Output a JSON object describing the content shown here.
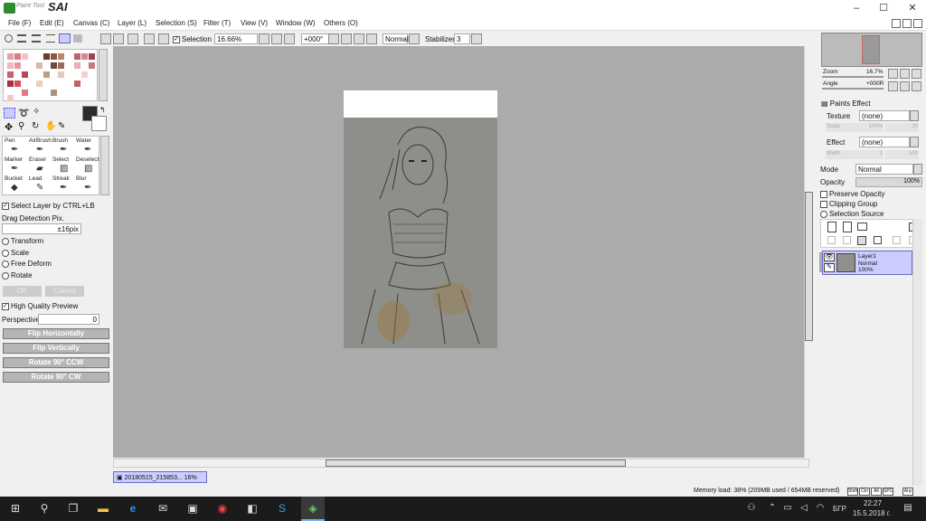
{
  "app": {
    "logo_text": "Paint Tool",
    "logo_name": "SAI"
  },
  "window_controls": {
    "minimize": "–",
    "maximize": "☐",
    "close": "✕"
  },
  "menu": [
    "File (F)",
    "Edit (E)",
    "Canvas (C)",
    "Layer (L)",
    "Selection (S)",
    "Filter (T)",
    "View (V)",
    "Window (W)",
    "Others (O)"
  ],
  "toolbar": {
    "selection_label": "Selection",
    "zoom": "16.66%",
    "angle": "+000°",
    "blend": "Normal",
    "stabilizer_label": "Stabilizer",
    "stabilizer_value": "3"
  },
  "tools": {
    "row1": [
      "Pen",
      "AirBrush",
      "Brush",
      "Water"
    ],
    "row2": [
      "Marker",
      "Eraser",
      "Select",
      "Deselect"
    ],
    "row3": [
      "Bucket",
      "Lead",
      "Streak",
      "Blur"
    ]
  },
  "left_options": {
    "select_layer": "Select Layer by CTRL+LB",
    "drag_detection": "Drag Detection Pix.",
    "drag_value": "±16pix",
    "transform_options": [
      "Transform",
      "Scale",
      "Free Deform",
      "Rotate"
    ],
    "ok": "OK",
    "cancel": "Cancel",
    "high_quality": "High Quality Preview",
    "perspective_label": "Perspective",
    "perspective_value": "0",
    "buttons": [
      "Flip Horizontally",
      "Flip Vertically",
      "Rotate 90° CCW",
      "Rotate 90° CW"
    ]
  },
  "navigator": {
    "zoom_label": "Zoom",
    "zoom_value": "16.7%",
    "angle_label": "Angle",
    "angle_value": "+000R"
  },
  "paints_effect": {
    "header": "Paints Effect",
    "texture_label": "Texture",
    "texture_value": "(none)",
    "scale_label": "Scale",
    "scale_value": "100%",
    "scale_num": "20",
    "effect_label": "Effect",
    "effect_value": "(none)",
    "width_label": "Width",
    "width_value": "1",
    "width_num": "100"
  },
  "layer_props": {
    "mode_label": "Mode",
    "mode_value": "Normal",
    "opacity_label": "Opacity",
    "opacity_value": "100%",
    "preserve": "Preserve Opacity",
    "clipping": "Clipping Group",
    "selection_source": "Selection Source"
  },
  "layer": {
    "name": "Layer1",
    "mode": "Normal",
    "opacity": "100%"
  },
  "doc_tab": {
    "name": "20180515_215853...",
    "zoom": "16%"
  },
  "status": {
    "memory": "Memory load: 38% (209MB used / 654MB reserved)",
    "keys": [
      "Shift",
      "Ctrl",
      "Alt",
      "SPC",
      "Any"
    ]
  },
  "taskbar": {
    "time": "22:27",
    "date": "15.5.2018 г.",
    "lang": "БГР"
  },
  "colors": {
    "main": "#2b2b2b",
    "accent_layer": "#ccccff"
  }
}
